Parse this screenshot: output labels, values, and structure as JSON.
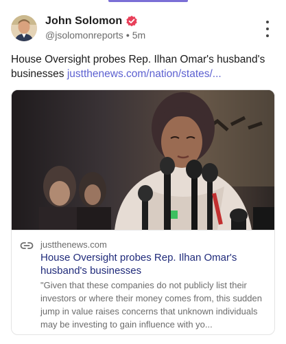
{
  "post": {
    "author_name": "John Solomon",
    "author_handle": "@jsolomonreports",
    "separator": "•",
    "time_ago": "5m",
    "text": "House Oversight probes Rep. Ilhan Omar's husband's businesses ",
    "link_text": "justthenews.com/nation/states/..."
  },
  "card": {
    "domain": "justthenews.com",
    "title": "House Oversight probes Rep. Ilhan Omar's husband's businesses",
    "description": "\"Given that these companies do not publicly list their investors or where their money comes from, this sudden jump in value raises concerns that unknown individuals may be investing to gain influence with yo..."
  },
  "colors": {
    "accent": "#7b6fd6",
    "link": "#5b5fd0",
    "verified_badge": "#e8405a",
    "card_title": "#1f2a7a"
  },
  "icons": {
    "verified": "verified-badge-icon",
    "more": "more-vertical-icon",
    "link": "link-icon"
  }
}
